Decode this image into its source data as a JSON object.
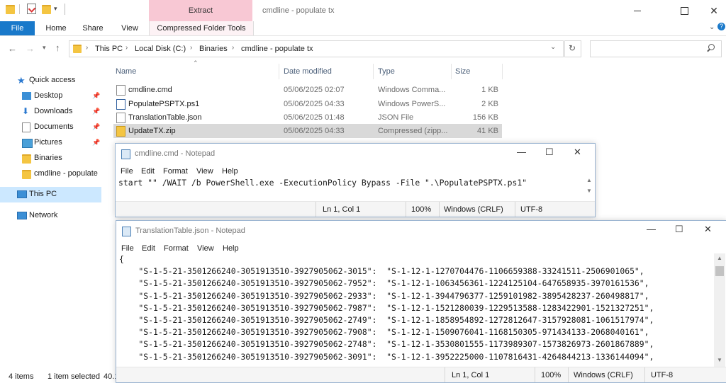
{
  "explorer": {
    "window_title": "cmdline - populate tx",
    "context_tab": "Extract",
    "ribbon_tabs": [
      "File",
      "Home",
      "Share",
      "View",
      "Compressed Folder Tools"
    ],
    "address": [
      "This PC",
      "Local Disk (C:)",
      "Binaries",
      "cmdline - populate tx"
    ],
    "nav": {
      "quick_access": "Quick access",
      "items": [
        "Desktop",
        "Downloads",
        "Documents",
        "Pictures",
        "Binaries",
        "cmdline - populate"
      ],
      "this_pc": "This PC",
      "network": "Network"
    },
    "columns": {
      "name": "Name",
      "date": "Date modified",
      "type": "Type",
      "size": "Size"
    },
    "files": [
      {
        "name": "cmdline.cmd",
        "date": "05/06/2025 02:07",
        "type": "Windows Comma...",
        "size": "1 KB"
      },
      {
        "name": "PopulatePSPTX.ps1",
        "date": "05/06/2025 04:33",
        "type": "Windows PowerS...",
        "size": "2 KB"
      },
      {
        "name": "TranslationTable.json",
        "date": "05/06/2025 01:48",
        "type": "JSON File",
        "size": "156 KB"
      },
      {
        "name": "UpdateTX.zip",
        "date": "05/06/2025 04:33",
        "type": "Compressed (zipp...",
        "size": "41 KB"
      }
    ],
    "status": {
      "items": "4 items",
      "selected": "1 item selected",
      "size": "40.1"
    }
  },
  "notepad1": {
    "title": "cmdline.cmd - Notepad",
    "menu": [
      "File",
      "Edit",
      "Format",
      "View",
      "Help"
    ],
    "text": "start \"\" /WAIT /b PowerShell.exe -ExecutionPolicy Bypass -File \".\\PopulatePSPTX.ps1\"",
    "status": {
      "pos": "Ln 1, Col 1",
      "zoom": "100%",
      "eol": "Windows (CRLF)",
      "enc": "UTF-8"
    }
  },
  "notepad2": {
    "title": "TranslationTable.json - Notepad",
    "menu": [
      "File",
      "Edit",
      "Format",
      "View",
      "Help"
    ],
    "lines": [
      "{",
      "    \"S-1-5-21-3501266240-3051913510-3927905062-3015\":  \"S-1-12-1-1270704476-1106659388-33241511-2506901065\",",
      "    \"S-1-5-21-3501266240-3051913510-3927905062-7952\":  \"S-1-12-1-1063456361-1224125104-647658935-3970161536\",",
      "    \"S-1-5-21-3501266240-3051913510-3927905062-2933\":  \"S-1-12-1-3944796377-1259101982-3895428237-260498817\",",
      "    \"S-1-5-21-3501266240-3051913510-3927905062-7987\":  \"S-1-12-1-1521280039-1229513588-1283422901-1521327251\",",
      "    \"S-1-5-21-3501266240-3051913510-3927905062-2749\":  \"S-1-12-1-1858954892-1272812647-3157928081-1061517974\",",
      "    \"S-1-5-21-3501266240-3051913510-3927905062-7908\":  \"S-1-12-1-1509076041-1168150305-971434133-2068040161\",",
      "    \"S-1-5-21-3501266240-3051913510-3927905062-2748\":  \"S-1-12-1-3530801555-1173989307-1573826973-2601867889\",",
      "    \"S-1-5-21-3501266240-3051913510-3927905062-3091\":  \"S-1-12-1-3952225000-1107816431-4264844213-1336144094\","
    ],
    "status": {
      "pos": "Ln 1, Col 1",
      "zoom": "100%",
      "eol": "Windows (CRLF)",
      "enc": "UTF-8"
    }
  }
}
